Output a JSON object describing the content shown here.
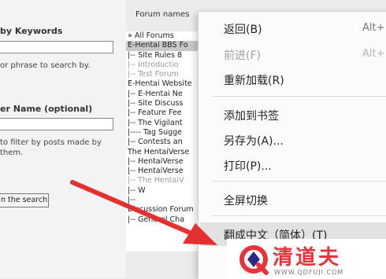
{
  "search_panel": {
    "keywords_heading": "by Keywords",
    "keywords_value": "",
    "keywords_help": "or phrase to search by.",
    "user_heading": "er Name (optional)",
    "user_value": "",
    "user_help": "to filter by posts made by them.",
    "search_button": "n the search"
  },
  "forum_panel": {
    "header": "Forum names",
    "items": [
      {
        "label": "» All Forums",
        "state": "normal"
      },
      {
        "label": "E-Hentai BBS Fo",
        "state": "selected"
      },
      {
        "label": "|-- Site Rules 8",
        "state": "normal"
      },
      {
        "label": "|-- Introductio",
        "state": "muted"
      },
      {
        "label": "|-- Test Forum",
        "state": "muted"
      },
      {
        "label": "E-Hentai Website",
        "state": "normal"
      },
      {
        "label": "|-- E-Hentai Ne",
        "state": "normal"
      },
      {
        "label": "|-- Site Discuss",
        "state": "normal"
      },
      {
        "label": "|-- Feature Fee",
        "state": "normal"
      },
      {
        "label": "|-- The Vigilant",
        "state": "normal"
      },
      {
        "label": "|---- Tag Sugge",
        "state": "normal"
      },
      {
        "label": "|-- Contests an",
        "state": "normal"
      },
      {
        "label": "The HentaiVerse",
        "state": "normal"
      },
      {
        "label": "|-- HentaiVerse",
        "state": "normal"
      },
      {
        "label": "|-- HentaiVerse",
        "state": "normal"
      },
      {
        "label": "|-- The HentaiV",
        "state": "muted"
      },
      {
        "label": "|-- W",
        "state": "normal"
      },
      {
        "label": "|-- ",
        "state": "normal"
      },
      {
        "label": "Discussion Forum",
        "state": "normal"
      },
      {
        "label": "|-- General Cha",
        "state": "normal"
      }
    ]
  },
  "context_menu": {
    "items": [
      {
        "label": "返回(B)",
        "shortcut": "Alt+",
        "disabled": false
      },
      {
        "label": "前进(F)",
        "shortcut": "Alt+",
        "disabled": true
      },
      {
        "label": "重新加载(R)",
        "shortcut": "",
        "disabled": false
      },
      {
        "label": "添加到书签",
        "shortcut": "",
        "disabled": false
      },
      {
        "label": "另存为(A)...",
        "shortcut": "",
        "disabled": false
      },
      {
        "label": "打印(P)...",
        "shortcut": "",
        "disabled": false
      },
      {
        "label": "全屏切换",
        "shortcut": "",
        "disabled": false
      },
      {
        "label": "翻成中文（简体）(T)",
        "shortcut": "",
        "disabled": false
      }
    ],
    "highlighted_index": 7
  },
  "watermark": {
    "name": "清道夫",
    "url": "WWW.QDFUJI.COM",
    "color": "#e8323c"
  },
  "annotation": {
    "arrow_color": "#e53030"
  }
}
